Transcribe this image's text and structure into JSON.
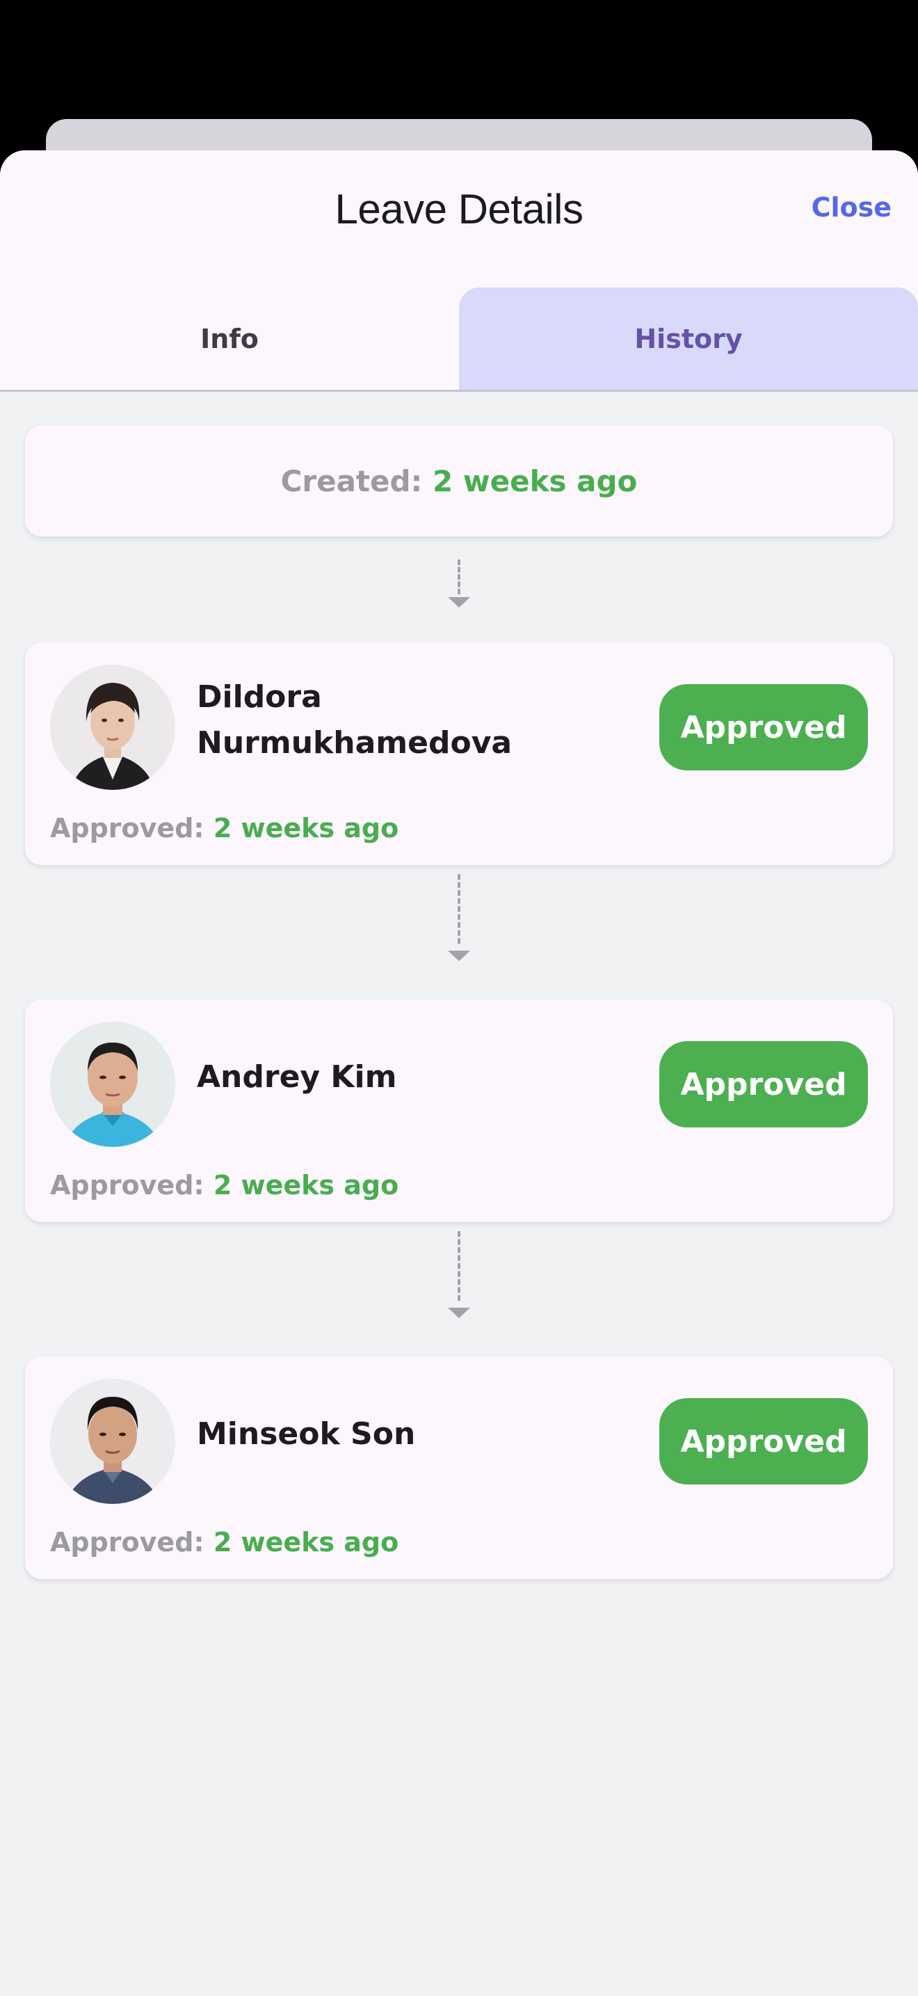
{
  "header": {
    "title": "Leave Details",
    "close_label": "Close"
  },
  "tabs": [
    {
      "label": "Info",
      "active": false
    },
    {
      "label": "History",
      "active": true
    }
  ],
  "history": {
    "created_label": "Created:",
    "created_value": "2 weeks ago",
    "approvers": [
      {
        "name_line1": "Dildora",
        "name_line2": "Nurmukhamedova",
        "status": "Approved",
        "status_label": "Approved:",
        "status_time": "2 weeks ago"
      },
      {
        "name_line1": "Andrey Kim",
        "status": "Approved",
        "status_label": "Approved:",
        "status_time": "2 weeks ago"
      },
      {
        "name_line1": "Minseok Son",
        "status": "Approved",
        "status_label": "Approved:",
        "status_time": "2 weeks ago"
      }
    ]
  },
  "colors": {
    "accent": "#5468e8",
    "approved_green": "#4cb050",
    "active_tab_bg": "#d9d9fb",
    "active_tab_text": "#6352a6",
    "card_bg": "#fcf6fd"
  }
}
